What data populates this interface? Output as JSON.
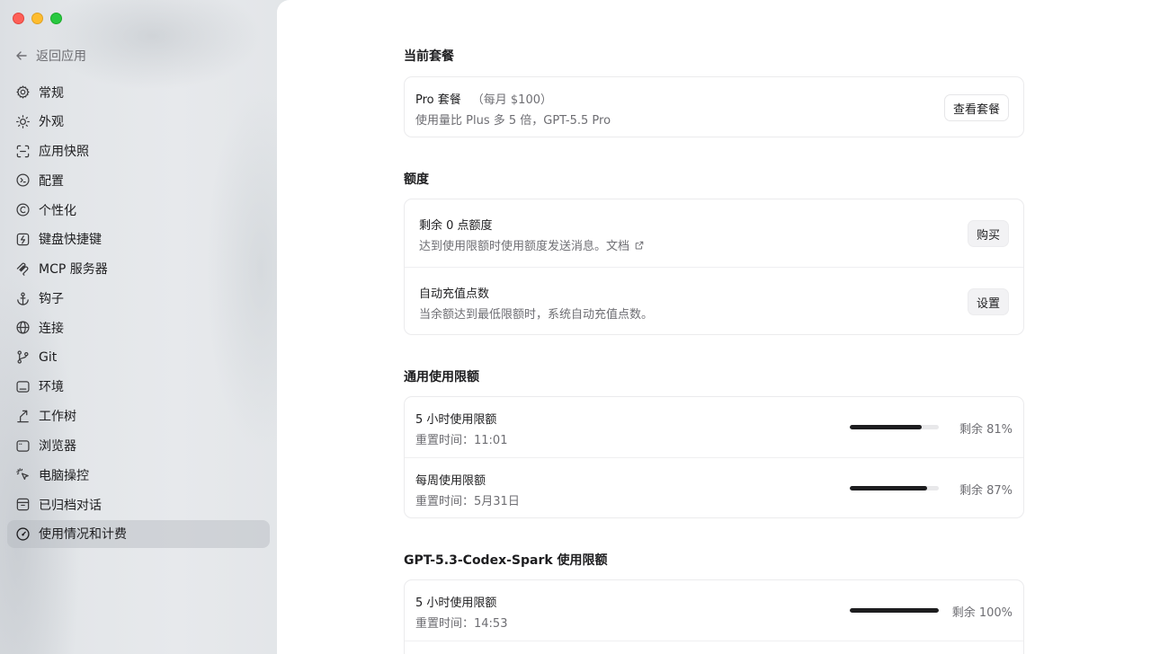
{
  "sidebar": {
    "back_label": "返回应用",
    "items": [
      {
        "label": "常规",
        "icon": "gear-icon"
      },
      {
        "label": "外观",
        "icon": "sun-icon"
      },
      {
        "label": "应用快照",
        "icon": "snapshot-icon"
      },
      {
        "label": "配置",
        "icon": "config-icon"
      },
      {
        "label": "个性化",
        "icon": "personalize-icon"
      },
      {
        "label": "键盘快捷键",
        "icon": "keyboard-shortcut-icon"
      },
      {
        "label": "MCP 服务器",
        "icon": "mcp-icon"
      },
      {
        "label": "钩子",
        "icon": "anchor-icon"
      },
      {
        "label": "连接",
        "icon": "globe-icon"
      },
      {
        "label": "Git",
        "icon": "git-branch-icon"
      },
      {
        "label": "环境",
        "icon": "environment-icon"
      },
      {
        "label": "工作树",
        "icon": "worktree-icon"
      },
      {
        "label": "浏览器",
        "icon": "browser-icon"
      },
      {
        "label": "电脑操控",
        "icon": "computer-control-icon"
      },
      {
        "label": "已归档对话",
        "icon": "archive-icon"
      },
      {
        "label": "使用情况和计费",
        "icon": "gauge-icon",
        "active": true
      }
    ]
  },
  "plan": {
    "section_title": "当前套餐",
    "name": "Pro 套餐",
    "price": "（每月 $100）",
    "description": "使用量比 Plus 多 5 倍，GPT-5.5 Pro",
    "button": "查看套餐"
  },
  "credits": {
    "section_title": "额度",
    "remaining": {
      "title": "剩余 0 点额度",
      "description": "达到使用限额时使用额度发送消息。文档",
      "button": "购买"
    },
    "auto_recharge": {
      "title": "自动充值点数",
      "description": "当余额达到最低限额时，系统自动充值点数。",
      "button": "设置"
    }
  },
  "general_limits": {
    "section_title": "通用使用限额",
    "rows": [
      {
        "title": "5 小时使用限额",
        "reset": "重置时间：11:01",
        "remaining_text": "剩余 81%",
        "fraction": 0.81
      },
      {
        "title": "每周使用限额",
        "reset": "重置时间：5月31日",
        "remaining_text": "剩余 87%",
        "fraction": 0.87
      }
    ]
  },
  "spark_limits": {
    "section_title": "GPT-5.3-Codex-Spark 使用限额",
    "rows": [
      {
        "title": "5 小时使用限额",
        "reset": "重置时间：14:53",
        "remaining_text": "剩余 100%",
        "fraction": 1.0
      }
    ]
  },
  "colors": {
    "sidebar_bg": "#e5e7ea",
    "active_item_bg": "#d2d5d9",
    "bar_fill": "#1d1d1f",
    "bar_track": "#e8e8ea"
  }
}
